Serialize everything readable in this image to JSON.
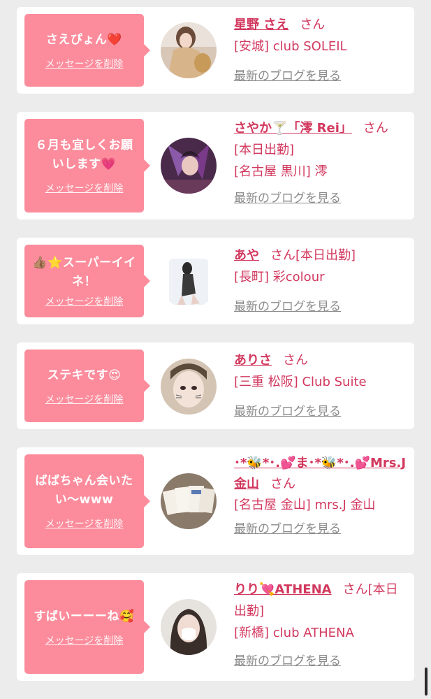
{
  "delete_label": "メッセージを削除",
  "blog_label": "最新のブログを見る",
  "san": "さん",
  "cards": [
    {
      "message": "さえぴょん❤️",
      "name": "星野 さえ",
      "tail": "",
      "lines": [
        "[安城] club SOLEIL"
      ]
    },
    {
      "message": "６月も宜しくお願いします💗",
      "name": "さやか🍸「澪 Rei」",
      "tail": "",
      "lines": [
        "[本日出勤]",
        "[名古屋 黒川] 澪"
      ]
    },
    {
      "message": "👍🏽⭐スーパーイイネ！",
      "name": "あや",
      "tail": "[本日出勤]",
      "lines": [
        "[長町] 彩colour"
      ]
    },
    {
      "message": "ステキです😍",
      "name": "ありさ",
      "tail": "",
      "lines": [
        "[三重 松阪] Club Suite"
      ]
    },
    {
      "message": "ばばちゃん会いたい〜www",
      "name": "･*🐝*･.💕ま･*🐝*･.💕Mrs.J金山",
      "tail": "",
      "lines": [
        "[名古屋 金山] mrs.J 金山"
      ]
    },
    {
      "message": "すばいーーーね🥰",
      "name": "りり💘ATHENA",
      "tail": "[本日出勤]",
      "lines": [
        "[新橋] club ATHENA"
      ]
    }
  ],
  "colors": {
    "bubble": "#fc8c9c",
    "name": "#d2385e",
    "link_gray": "#8a8a8a",
    "page_bg": "#ececec"
  }
}
